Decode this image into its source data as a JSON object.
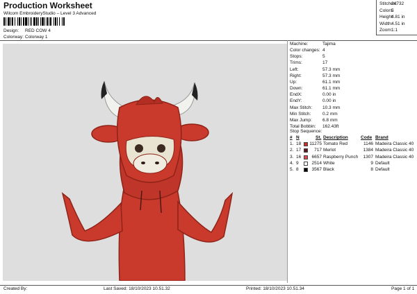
{
  "header": {
    "title": "Production Worksheet",
    "subtitle": "Wilcom EmbroideryStudio – Level 3 Advanced",
    "design_label": "Design:",
    "design_value": "RED COW 4",
    "colorway_label": "Colorway:",
    "colorway_value": "Colorway 1"
  },
  "stats": [
    {
      "label": "Stitches:",
      "value": "24732"
    },
    {
      "label": "Colors:",
      "value": "5"
    },
    {
      "label": "Height:",
      "value": "4.81 in"
    },
    {
      "label": "Width:",
      "value": "4.51 in"
    },
    {
      "label": "Zoom:",
      "value": "1:1"
    }
  ],
  "details": [
    {
      "label": "Machine:",
      "value": "Tajima"
    },
    {
      "label": "Color changes:",
      "value": "4"
    },
    {
      "label": "Stops:",
      "value": "5"
    },
    {
      "label": "Trims:",
      "value": "17"
    },
    {
      "label": "Left:",
      "value": "57.3 mm"
    },
    {
      "label": "Right:",
      "value": "57.3 mm"
    },
    {
      "label": "Up:",
      "value": "61.1 mm"
    },
    {
      "label": "Down:",
      "value": "61.1 mm"
    },
    {
      "label": "EndX:",
      "value": "0.00 in"
    },
    {
      "label": "EndY:",
      "value": "0.00 in"
    },
    {
      "label": "Max Stitch:",
      "value": "10.3 mm"
    },
    {
      "label": "Min Stitch:",
      "value": "0.2 mm"
    },
    {
      "label": "Max Jump:",
      "value": "6.8 mm"
    },
    {
      "label": "Total Bobbin:",
      "value": "162.43ft"
    }
  ],
  "stop_sequence": {
    "title": "Stop Sequence:",
    "columns": [
      "#",
      "N",
      "St.",
      "Description",
      "Code",
      "Brand"
    ],
    "rows": [
      {
        "num": "1.",
        "n": "18",
        "st": "11275",
        "description": "Tomato Red",
        "code": "1146",
        "brand": "Madeira Classic 40",
        "color": "#c4322a"
      },
      {
        "num": "2.",
        "n": "17",
        "st": "717",
        "description": "Merlot",
        "code": "1384",
        "brand": "Madeira Classic 40",
        "color": "#5b1a22"
      },
      {
        "num": "3.",
        "n": "16",
        "st": "6657",
        "description": "Raspberry Punch",
        "code": "1307",
        "brand": "Madeira Classic 40",
        "color": "#d84a55"
      },
      {
        "num": "4.",
        "n": "9",
        "st": "2514",
        "description": "White",
        "code": "9",
        "brand": "Default",
        "color": "#ffffff"
      },
      {
        "num": "5.",
        "n": "8",
        "st": "3567",
        "description": "Black",
        "code": "8",
        "brand": "Default",
        "color": "#000000"
      }
    ]
  },
  "footer": {
    "created_by": "Created By:",
    "last_saved": "Last Saved: 18/10/2023 10.51.32",
    "printed": "Printed: 18/10/2023 10.51.34",
    "page": "Page 1 of 1"
  }
}
